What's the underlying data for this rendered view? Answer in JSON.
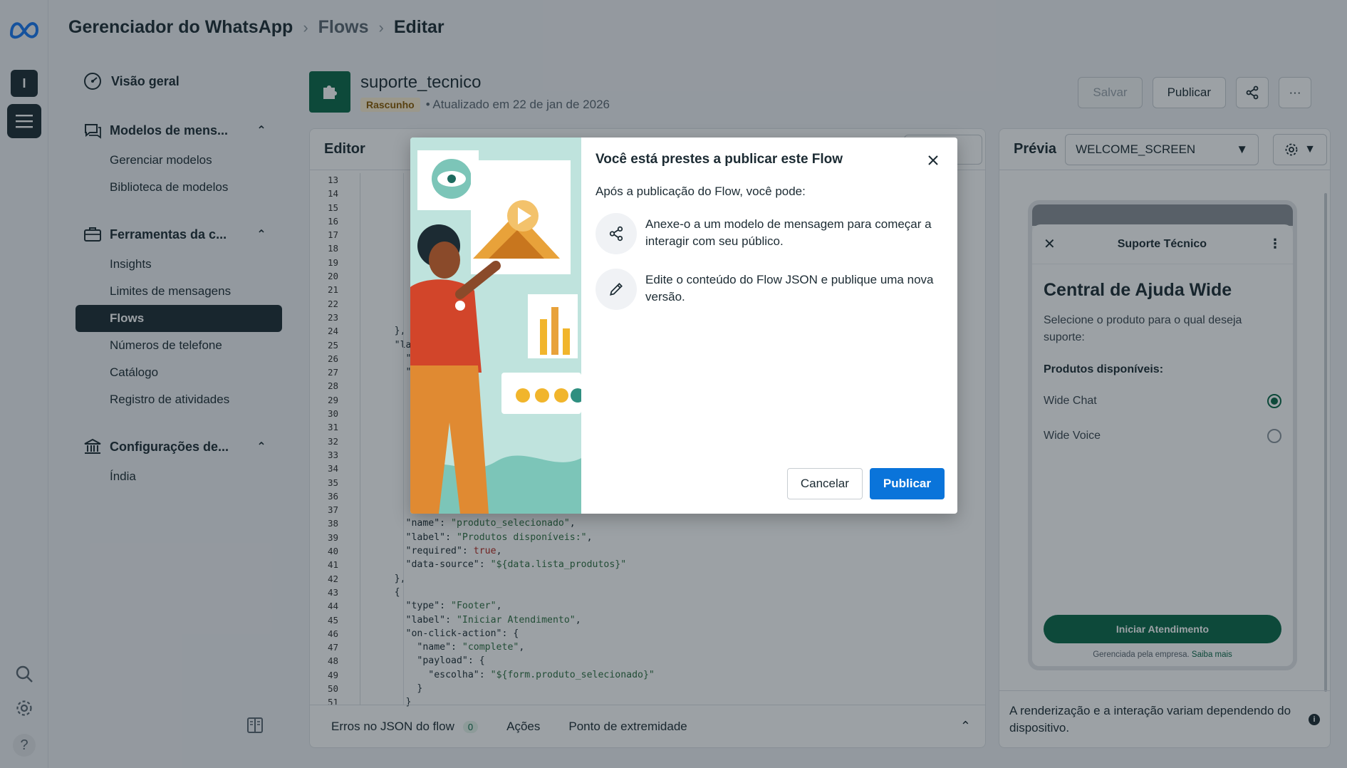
{
  "header": {
    "breadcrumb": [
      "Gerenciador do WhatsApp",
      "Flows",
      "Editar"
    ]
  },
  "rail": {
    "avatar_letter": "I",
    "icons": [
      "meta-logo-icon",
      "menu-icon",
      "search-icon",
      "settings-icon",
      "help-icon"
    ],
    "help_label": "?"
  },
  "leftnav": {
    "overview": "Visão geral",
    "sections": [
      {
        "label": "Modelos de mens...",
        "icon": "chat-icon",
        "items": [
          "Gerenciar modelos",
          "Biblioteca de modelos"
        ]
      },
      {
        "label": "Ferramentas da c...",
        "icon": "briefcase-icon",
        "items": [
          "Insights",
          "Limites de mensagens",
          "Flows",
          "Números de telefone",
          "Catálogo",
          "Registro de atividades"
        ]
      },
      {
        "label": "Configurações de...",
        "icon": "bank-icon",
        "items": [
          "Índia"
        ]
      }
    ],
    "active_item": "Flows"
  },
  "flow": {
    "name": "suporte_tecnico",
    "status": "Rascunho",
    "updated": "• Atualizado em 22 de jan de 2026"
  },
  "actions": {
    "save": "Salvar",
    "publish": "Publicar",
    "more": "···"
  },
  "editor": {
    "title": "Editor",
    "line_numbers": [
      13,
      14,
      15,
      16,
      17,
      18,
      19,
      20,
      21,
      22,
      23,
      24,
      25,
      26,
      27,
      28,
      29,
      30,
      31,
      32,
      33,
      34,
      35,
      36,
      37,
      38,
      39,
      40,
      41,
      42,
      43,
      44,
      45,
      46,
      47,
      48,
      49,
      50,
      51
    ],
    "code_lines": [
      "",
      "",
      "",
      "",
      "",
      "",
      "",
      "",
      "",
      "",
      "          }",
      "      },",
      "      \"la",
      "        \"",
      "        \"",
      "",
      "",
      "",
      "",
      "",
      "",
      "",
      "",
      "",
      "",
      "        \"name\": \"produto_selecionado\",",
      "        \"label\": \"Produtos disponíveis:\",",
      "        \"required\": true,",
      "        \"data-source\": \"${data.lista_produtos}\"",
      "      },",
      "      {",
      "        \"type\": \"Footer\",",
      "        \"label\": \"Iniciar Atendimento\",",
      "        \"on-click-action\": {",
      "          \"name\": \"complete\",",
      "          \"payload\": {",
      "            \"escolha\": \"${form.produto_selecionado}\"",
      "          }",
      "        }"
    ],
    "footer_tabs": {
      "errors": "Erros no JSON do flow",
      "error_count": "0",
      "actions": "Ações",
      "endpoint": "Ponto de extremidade"
    }
  },
  "preview": {
    "title": "Prévia",
    "screen": "WELCOME_SCREEN",
    "phone": {
      "header_title": "Suporte Técnico",
      "heading": "Central de Ajuda Wide",
      "description": "Selecione o produto para o qual deseja suporte:",
      "options_label": "Produtos disponíveis:",
      "options": [
        {
          "label": "Wide Chat",
          "selected": true
        },
        {
          "label": "Wide Voice",
          "selected": false
        }
      ],
      "cta": "Iniciar Atendimento",
      "managed_text": "Gerenciada pela empresa.",
      "learn_more": "Saiba mais"
    },
    "footer_note": "A renderização e a interação variam dependendo do dispositivo."
  },
  "dialog": {
    "title": "Você está prestes a publicar este Flow",
    "intro": "Após a publicação do Flow, você pode:",
    "items": [
      {
        "icon": "share-icon",
        "text": "Anexe-o a um modelo de mensagem para começar a interagir com seu público."
      },
      {
        "icon": "pencil-icon",
        "text": "Edite o conteúdo do Flow JSON e publique uma nova versão."
      }
    ],
    "cancel": "Cancelar",
    "publish": "Publicar"
  },
  "colors": {
    "primary_blue": "#0a74da",
    "whatsapp_green": "#0a6847",
    "dark": "#1c2b33"
  }
}
